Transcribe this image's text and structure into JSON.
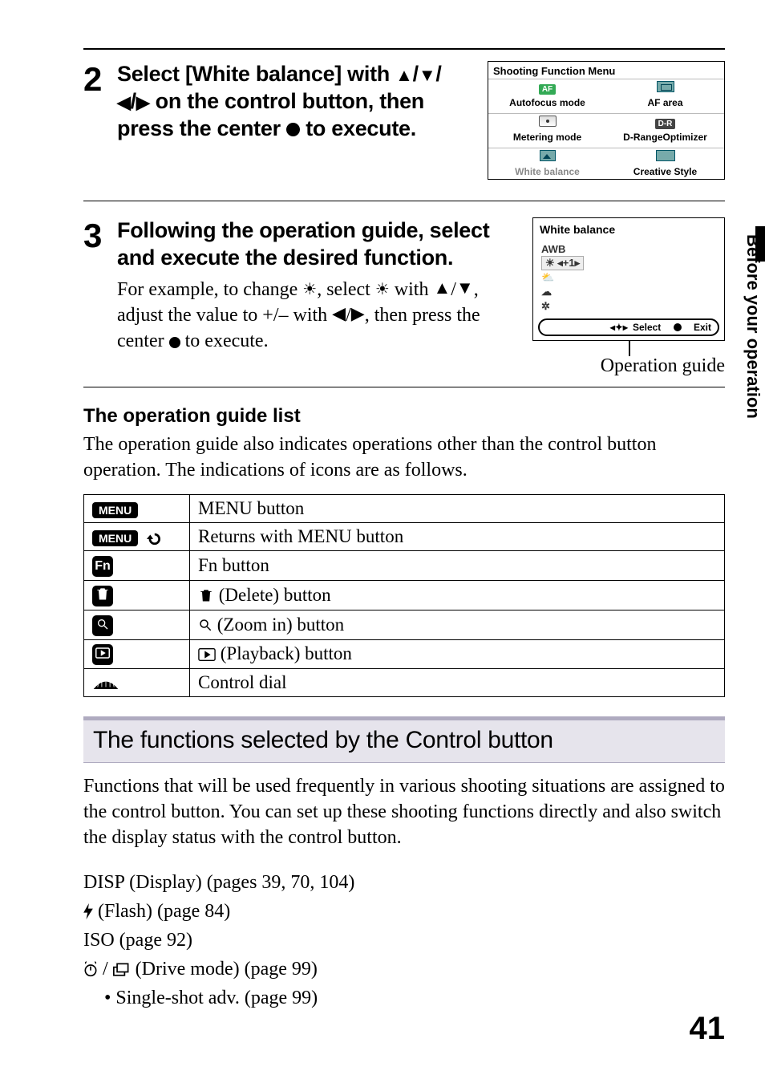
{
  "step2": {
    "number": "2",
    "line1_a": "Select [White balance] with ",
    "line1_b": "/",
    "line2_a": "on the control button, then press the center ",
    "line2_c": " to execute."
  },
  "sfm": {
    "title": "Shooting Function Menu",
    "cells": [
      {
        "icon": "af-badge",
        "label": "Autofocus mode"
      },
      {
        "icon": "af-area",
        "label": "AF area"
      },
      {
        "icon": "metering",
        "label": "Metering mode"
      },
      {
        "icon": "dr-badge",
        "label": "D-RangeOptimizer"
      },
      {
        "icon": "picture",
        "label": "White balance",
        "selected": true
      },
      {
        "icon": "teal",
        "label": "Creative Style"
      }
    ]
  },
  "step3": {
    "number": "3",
    "heading": "Following the operation guide, select and execute the desired function.",
    "example_a": "For example, to change ",
    "example_b": ", select ",
    "example_c": " with ",
    "example_d": ", adjust the value to +/– with ",
    "example_e": ", then press the center ",
    "example_f": " to execute."
  },
  "wb": {
    "title": "White balance",
    "items": [
      "AWB",
      "☀ ◂+1▸",
      "⛅",
      "☁",
      "✲"
    ],
    "footer_select": "Select",
    "footer_exit": "Exit"
  },
  "op_guide_label": "Operation guide",
  "guide_list": {
    "heading": "The operation guide list",
    "intro": "The operation guide also indicates operations other than the control button operation. The indications of icons are as follows.",
    "rows": [
      {
        "icon": "menu-pill",
        "label": "MENU button"
      },
      {
        "icon": "menu-undo",
        "label": "Returns with MENU button"
      },
      {
        "icon": "fn-sq",
        "label": "Fn button"
      },
      {
        "icon": "trash-sq",
        "prefix_icon": "trash",
        "label": " (Delete) button"
      },
      {
        "icon": "mag-sq",
        "prefix_icon": "mag",
        "label": " (Zoom in) button"
      },
      {
        "icon": "play-sq",
        "prefix_icon": "play",
        "label": " (Playback) button"
      },
      {
        "icon": "dial",
        "label": "Control dial"
      }
    ]
  },
  "section": {
    "bar": "The functions selected by the Control button",
    "body": "Functions that will be used frequently in various shooting situations are assigned to the control button. You can set up these shooting functions directly and also switch the display status with the control button.",
    "items": [
      "DISP (Display) (pages 39, 70, 104)",
      " (Flash) (page 84)",
      "ISO (page 92)",
      " (Drive mode) (page 99)"
    ],
    "sub": "Single-shot adv. (page 99)"
  },
  "side_tab": "Before your operation",
  "page_number": "41"
}
